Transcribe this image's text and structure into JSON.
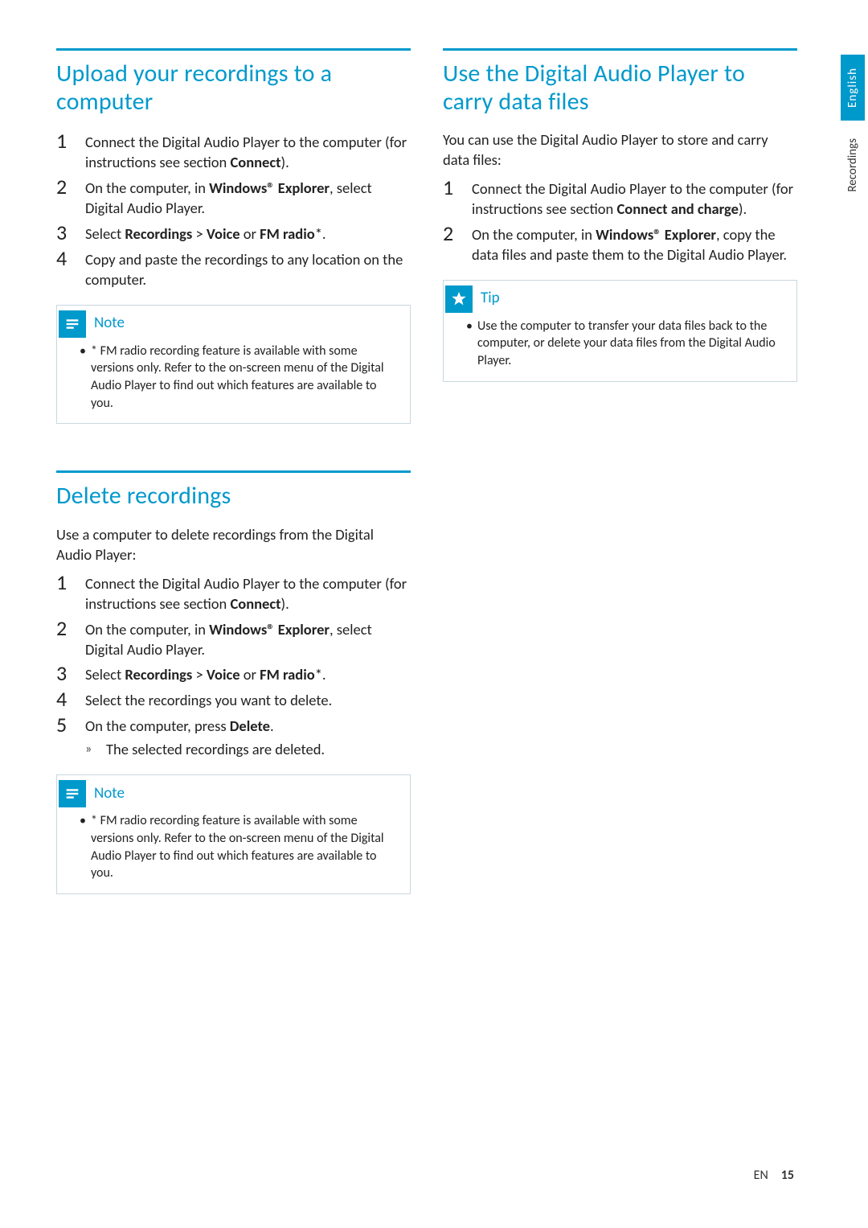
{
  "sideTabs": {
    "active": "English",
    "inactive": "Recordings"
  },
  "left": {
    "upload": {
      "heading": "Upload your recordings to a computer",
      "steps": [
        {
          "n": "1",
          "pre": "Connect the Digital Audio Player to the computer (for instructions see section ",
          "bold": "Connect",
          "post": ")."
        },
        {
          "n": "2",
          "pre": "On the computer, in ",
          "bold": "Windows® Explorer",
          "post": ", select Digital Audio Player."
        },
        {
          "n": "3",
          "pre": "Select ",
          "bold": "Recordings",
          "post": " > ",
          "bold2": "Voice",
          "post2": " or ",
          "bold3": "FM radio",
          "post3": "*."
        },
        {
          "n": "4",
          "pre": "Copy and paste the recordings to any location on the computer.",
          "bold": "",
          "post": ""
        }
      ],
      "note": {
        "label": "Note",
        "items": [
          "* FM radio recording feature is available with some versions only. Refer to the on-screen menu of the Digital Audio Player to find out which features are available to you."
        ]
      }
    },
    "delete": {
      "heading": "Delete recordings",
      "intro": "Use a computer to delete recordings from the Digital Audio Player:",
      "steps": [
        {
          "n": "1",
          "pre": "Connect the Digital Audio Player to the computer (for instructions see section ",
          "bold": "Connect",
          "post": ")."
        },
        {
          "n": "2",
          "pre": "On the computer, in ",
          "bold": "Windows® Explorer",
          "post": ", select Digital Audio Player."
        },
        {
          "n": "3",
          "pre": "Select ",
          "bold": "Recordings",
          "post": " > ",
          "bold2": "Voice",
          "post2": " or ",
          "bold3": "FM radio",
          "post3": "*."
        },
        {
          "n": "4",
          "pre": "Select the recordings you want to delete.",
          "bold": "",
          "post": ""
        },
        {
          "n": "5",
          "pre": "On the computer, press ",
          "bold": "Delete",
          "post": ".",
          "sub": "The selected recordings are deleted."
        }
      ],
      "note": {
        "label": "Note",
        "items": [
          "* FM radio recording feature is available with some versions only. Refer to the on-screen menu of the Digital Audio Player to find out which features are available to you."
        ]
      }
    }
  },
  "right": {
    "carry": {
      "heading": "Use the Digital Audio Player to carry data files",
      "intro": "You can use the Digital Audio Player to store and carry data files:",
      "steps": [
        {
          "n": "1",
          "pre": "Connect the Digital Audio Player to the computer (for instructions see section ",
          "bold": "Connect and charge",
          "post": ")."
        },
        {
          "n": "2",
          "pre": "On the computer, in ",
          "bold": "Windows® Explorer",
          "post": ", copy the data files and paste them to the Digital Audio Player."
        }
      ],
      "tip": {
        "label": "Tip",
        "items": [
          "Use the computer to transfer your data files back to the computer, or delete your data files from the Digital Audio Player."
        ]
      }
    }
  },
  "footer": {
    "lang": "EN",
    "page": "15"
  },
  "glyphs": {
    "subArrow": "»"
  }
}
